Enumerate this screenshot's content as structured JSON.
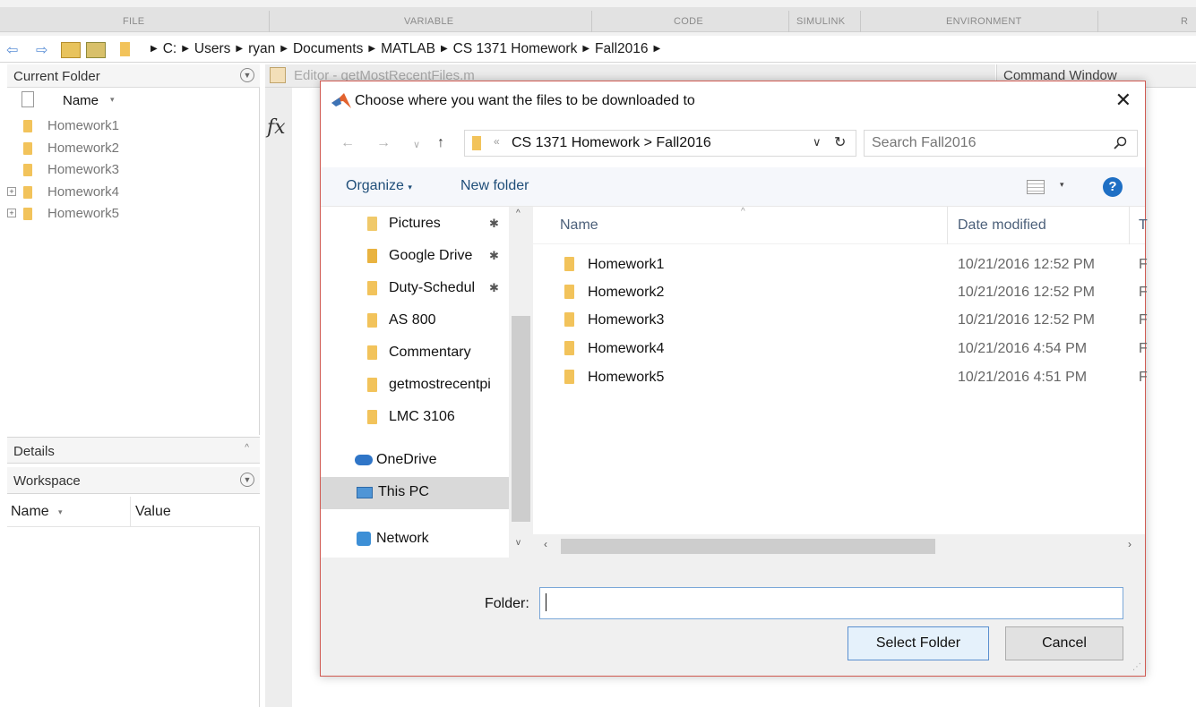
{
  "toolstrip": {
    "sections": [
      "FILE",
      "VARIABLE",
      "CODE",
      "SIMULINK",
      "ENVIRONMENT",
      "R"
    ]
  },
  "address_bar": {
    "crumbs": [
      "C:",
      "Users",
      "ryan",
      "Documents",
      "MATLAB",
      "CS 1371 Homework",
      "Fall2016"
    ]
  },
  "current_folder": {
    "title": "Current Folder",
    "column": "Name",
    "items": [
      "Homework1",
      "Homework2",
      "Homework3",
      "Homework4",
      "Homework5"
    ]
  },
  "details": {
    "title": "Details"
  },
  "workspace": {
    "title": "Workspace",
    "col_name": "Name",
    "col_value": "Value"
  },
  "editor": {
    "tab": "Editor - getMostRecentFiles.m",
    "fx": "fx"
  },
  "command_window": {
    "title": "Command Window"
  },
  "dialog": {
    "title": "Choose where you want the files to be downloaded to",
    "path_crumbs": "CS 1371 Homework  >  Fall2016",
    "search_placeholder": "Search Fall2016",
    "organize": "Organize",
    "new_folder": "New folder",
    "nav_items": [
      "Pictures",
      "Google Drive",
      "Duty-Schedul",
      "AS 800",
      "Commentary",
      "getmostrecentpi",
      "LMC 3106",
      "OneDrive",
      "This PC",
      "Network"
    ],
    "columns": {
      "name": "Name",
      "date": "Date modified",
      "type": "T"
    },
    "files": [
      {
        "name": "Homework1",
        "date": "10/21/2016 12:52 PM",
        "type": "F"
      },
      {
        "name": "Homework2",
        "date": "10/21/2016 12:52 PM",
        "type": "F"
      },
      {
        "name": "Homework3",
        "date": "10/21/2016 12:52 PM",
        "type": "F"
      },
      {
        "name": "Homework4",
        "date": "10/21/2016 4:54 PM",
        "type": "F"
      },
      {
        "name": "Homework5",
        "date": "10/21/2016 4:51 PM",
        "type": "F"
      }
    ],
    "folder_label": "Folder:",
    "folder_value": "",
    "select_button": "Select Folder",
    "cancel_button": "Cancel"
  },
  "colors": {
    "accent": "#1f4e79",
    "folder": "#f2c35b",
    "dialog_border": "#d05a52",
    "help": "#1e6fc4"
  }
}
